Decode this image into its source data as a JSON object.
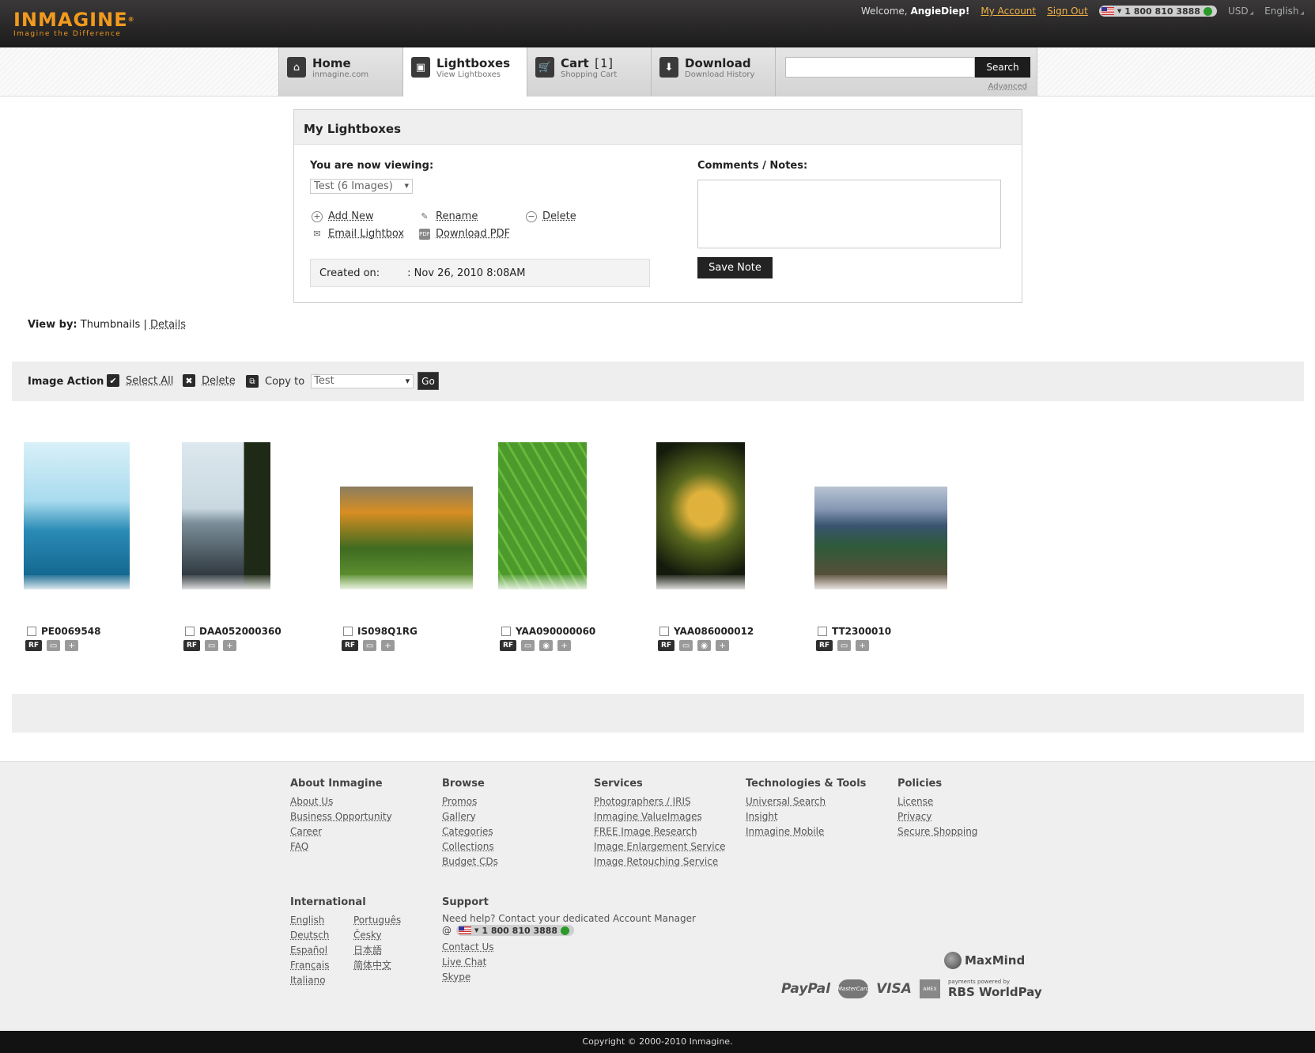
{
  "brand": {
    "logo": "INMAGINE",
    "reg": "®",
    "tagline": "Imagine the Difference",
    "accent": "#f29a1d"
  },
  "topbar": {
    "welcome_prefix": "Welcome,",
    "username": "AngieDiep!",
    "my_account": "My Account",
    "sign_out": "Sign Out",
    "phone": "1 800 810 3888",
    "currency": "USD",
    "language": "English"
  },
  "nav": {
    "tabs": [
      {
        "label": "Home",
        "sub": "inmagine.com",
        "icon": "home-icon",
        "glyph": "⌂"
      },
      {
        "label": "Lightboxes",
        "sub": "View Lightboxes",
        "icon": "lightbox-icon",
        "glyph": "▣"
      },
      {
        "label": "Cart",
        "count": "[1]",
        "sub": "Shopping Cart",
        "icon": "cart-icon",
        "glyph": "🛒"
      },
      {
        "label": "Download",
        "sub": "Download History",
        "icon": "download-icon",
        "glyph": "⬇"
      }
    ],
    "search_value": "",
    "search_button": "Search",
    "advanced": "Advanced"
  },
  "lightbox": {
    "title": "My Lightboxes",
    "viewing_label": "You are now viewing:",
    "selected": "Test (6 Images)",
    "actions": {
      "add_new": "Add New",
      "rename": "Rename",
      "delete": "Delete",
      "email": "Email Lightbox",
      "download_pdf": "Download PDF"
    },
    "created_label": "Created on:",
    "created_value": ": Nov 26, 2010 8:08AM",
    "notes_label": "Comments / Notes:",
    "notes_value": "",
    "save_note": "Save Note"
  },
  "viewby": {
    "label": "View by:",
    "current": "Thumbnails",
    "sep": "|",
    "other": "Details"
  },
  "image_action": {
    "title": "Image Action",
    "select_all": "Select All",
    "delete": "Delete",
    "copy_to": "Copy to",
    "copy_target": "Test",
    "go": "Go"
  },
  "images": [
    {
      "id": "PE0069548",
      "rf": "RF",
      "tools": [
        "comment-icon",
        "add-icon"
      ]
    },
    {
      "id": "DAA052000360",
      "rf": "RF",
      "tools": [
        "comment-icon",
        "add-icon"
      ]
    },
    {
      "id": "IS098Q1RG",
      "rf": "RF",
      "tools": [
        "comment-icon",
        "add-icon"
      ]
    },
    {
      "id": "YAA090000060",
      "rf": "RF",
      "tools": [
        "comment-icon",
        "zoom-icon",
        "add-icon"
      ]
    },
    {
      "id": "YAA086000012",
      "rf": "RF",
      "tools": [
        "comment-icon",
        "zoom-icon",
        "add-icon"
      ]
    },
    {
      "id": "TT2300010",
      "rf": "RF",
      "tools": [
        "comment-icon",
        "add-icon"
      ]
    }
  ],
  "footer": {
    "about": {
      "title": "About Inmagine",
      "links": [
        "About Us",
        "Business Opportunity",
        "Career",
        "FAQ"
      ]
    },
    "browse": {
      "title": "Browse",
      "links": [
        "Promos",
        "Gallery",
        "Categories",
        "Collections",
        "Budget CDs"
      ]
    },
    "services": {
      "title": "Services",
      "links": [
        "Photographers / IRIS",
        "Inmagine ValueImages",
        "FREE Image Research",
        "Image Enlargement Service",
        "Image Retouching Service"
      ]
    },
    "tech": {
      "title": "Technologies & Tools",
      "links": [
        "Universal Search",
        "Insight",
        "Inmagine Mobile"
      ]
    },
    "policies": {
      "title": "Policies",
      "links": [
        "License",
        "Privacy",
        "Secure Shopping"
      ]
    },
    "international": {
      "title": "International",
      "links": [
        "English",
        "Português",
        "Deutsch",
        "Česky",
        "Español",
        "日本語",
        "Français",
        "简体中文",
        "Italiano"
      ]
    },
    "support": {
      "title": "Support",
      "text": "Need help? Contact your dedicated Account Manager",
      "at": "@",
      "phone": "1 800 810 3888",
      "links": [
        "Contact Us",
        "Live Chat",
        "Skype"
      ]
    },
    "payments": {
      "paypal": "PayPal",
      "mastercard": "MasterCard",
      "visa": "VISA",
      "worldpay_small": "payments powered by",
      "worldpay": "RBS WorldPay",
      "maxmind": "MaxMind"
    },
    "copyright": "Copyright © 2000-2010 Inmagine."
  }
}
